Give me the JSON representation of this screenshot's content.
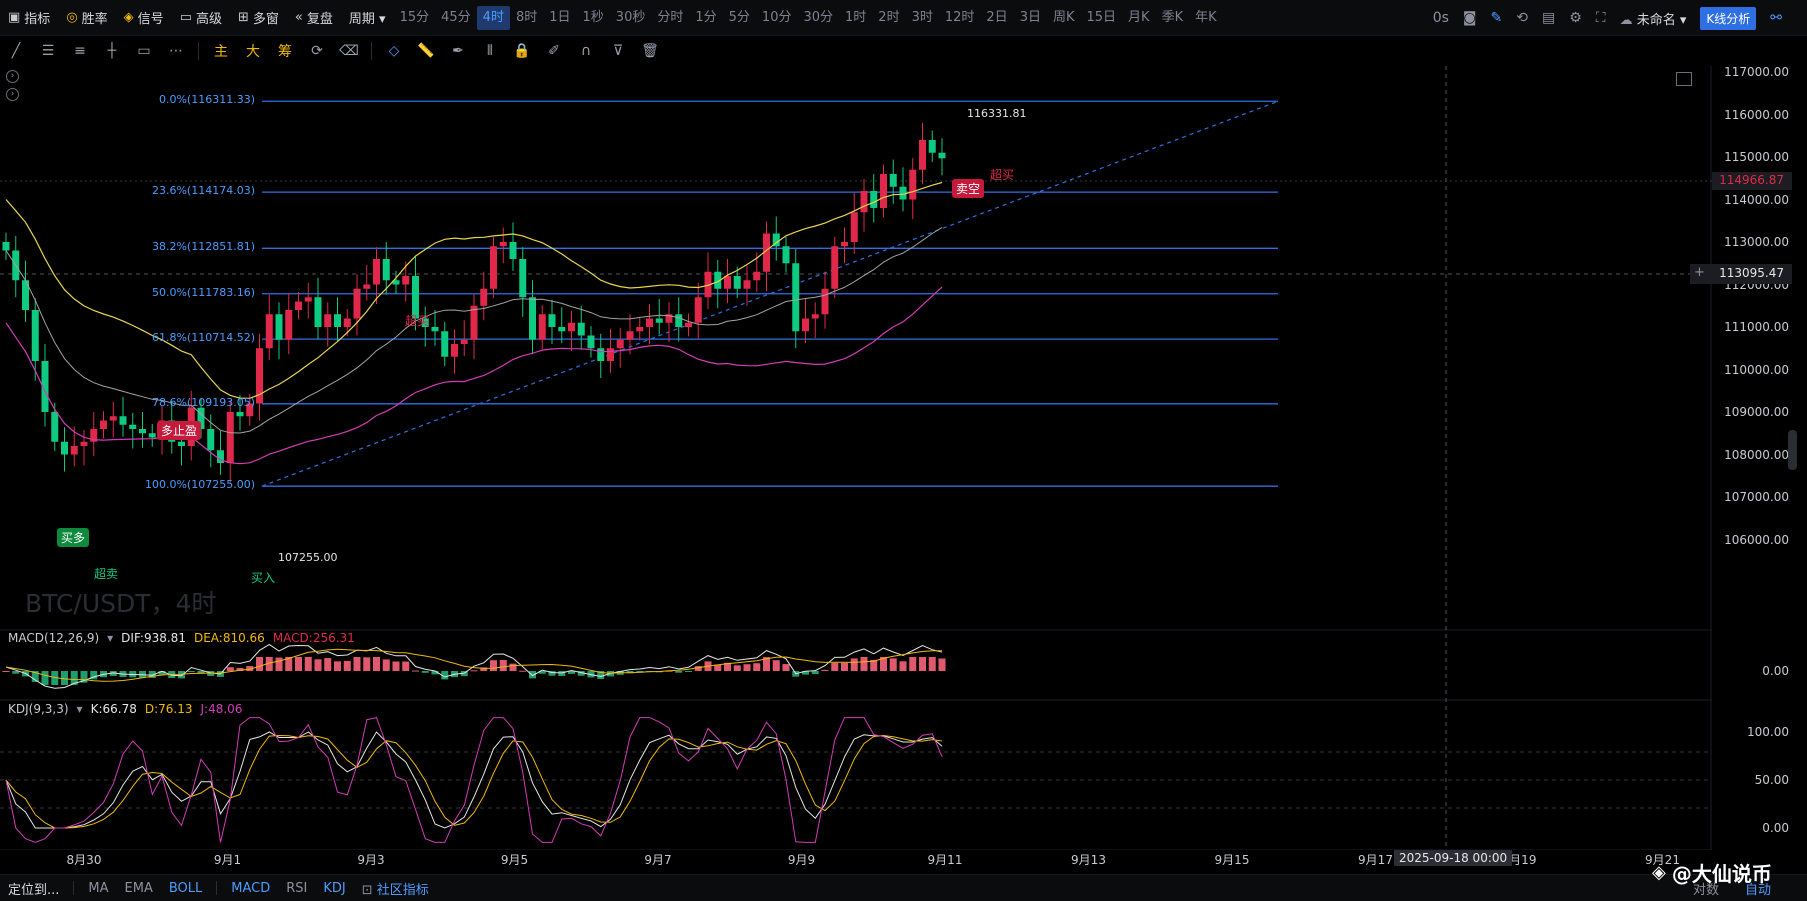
{
  "toolbar": {
    "items": [
      {
        "icon": "indicator-icon",
        "glyph": "▣",
        "label": "指标"
      },
      {
        "icon": "winrate-icon",
        "glyph": "◎",
        "label": "胜率"
      },
      {
        "icon": "signal-icon",
        "glyph": "◈",
        "label": "信号"
      },
      {
        "icon": "advanced-icon",
        "glyph": "▭",
        "label": "高级"
      },
      {
        "icon": "multiwindow-icon",
        "glyph": "⊞",
        "label": "多窗"
      },
      {
        "icon": "replay-icon",
        "glyph": "«",
        "label": "复盘"
      },
      {
        "icon": "period-icon",
        "glyph": "",
        "label": "周期 ▾"
      }
    ],
    "timeframes": [
      "15分",
      "45分",
      "4时",
      "8时",
      "1日",
      "1秒",
      "30秒",
      "分时",
      "1分",
      "5分",
      "10分",
      "30分",
      "1时",
      "2时",
      "3时",
      "12时",
      "2日",
      "3日",
      "周K",
      "15日",
      "月K",
      "季K",
      "年K"
    ],
    "active_timeframe": "4时",
    "right": {
      "latency": "0s",
      "unnamed": "未命名 ▾",
      "kline_analysis": "K线分析"
    }
  },
  "drawing_tools": {
    "left": [
      "trendline-icon",
      "horizontal-lines-icon",
      "parallel-lines-icon",
      "crosshair-line-icon",
      "rectangle-icon",
      "more-icon"
    ],
    "middle_labels": [
      "主",
      "大",
      "筹"
    ],
    "right": [
      "loop-icon",
      "eraser-icon",
      "shape-icon",
      "ruler-icon",
      "pen-icon",
      "candle-tool-icon",
      "lock-icon",
      "edit-icon",
      "magnet-icon",
      "filter-icon",
      "trash-icon"
    ]
  },
  "main_chart": {
    "symbol_watermark": "BTC/USDT，4时",
    "price_axis": [
      "117000.00",
      "116000.00",
      "115000.00",
      "114000.00",
      "113000.00",
      "112000.00",
      "111000.00",
      "110000.00",
      "109000.00",
      "108000.00",
      "107000.00",
      "106000.00"
    ],
    "current_price": "114966.87",
    "crosshair_price": "113095.47",
    "high_label": "116331.81",
    "low_label": "107255.00",
    "fib_levels": [
      {
        "label": "0.0%(116311.33)",
        "price": 116311.33
      },
      {
        "label": "23.6%(114174.03)",
        "price": 114174.03
      },
      {
        "label": "38.2%(112851.81)",
        "price": 112851.81
      },
      {
        "label": "50.0%(111783.16)",
        "price": 111783.16
      },
      {
        "label": "61.8%(110714.52)",
        "price": 110714.52
      },
      {
        "label": "78.6%(109193.05)",
        "price": 109193.05
      },
      {
        "label": "100.0%(107255.00)",
        "price": 107255.0
      }
    ],
    "signals": [
      {
        "text": "买多",
        "kind": "buy-long-chip"
      },
      {
        "text": "超卖",
        "kind": "oversold-text"
      },
      {
        "text": "多止盈",
        "kind": "take-profit-chip"
      },
      {
        "text": "买入",
        "kind": "buy-text"
      },
      {
        "text": "超买",
        "kind": "overbought-text-1"
      },
      {
        "text": "卖空",
        "kind": "sell-short-chip"
      },
      {
        "text": "超买",
        "kind": "overbought-text-2"
      }
    ]
  },
  "macd": {
    "name": "MACD(12,26,9)",
    "dif": "DIF:938.81",
    "dea": "DEA:810.66",
    "macd": "MACD:256.31",
    "axis": [
      "0.00"
    ]
  },
  "kdj": {
    "name": "KDJ(9,3,3)",
    "k": "K:66.78",
    "d": "D:76.13",
    "j": "J:48.06",
    "axis": [
      "100.00",
      "50.00",
      "0.00"
    ]
  },
  "time_axis": {
    "labels": [
      "8月30",
      "9月1",
      "9月3",
      "9月5",
      "9月7",
      "9月9",
      "9月11",
      "9月13",
      "9月15",
      "9月17",
      "9月19",
      "9月21"
    ],
    "crosshair_time": "2025-09-18 00:00"
  },
  "bottom_bar": {
    "locate": "定位到...",
    "indicators": [
      "MA",
      "EMA",
      "BOLL"
    ],
    "sub_indicators": [
      "MACD",
      "RSI",
      "KDJ"
    ],
    "community": "社区指标",
    "right": [
      "对数",
      "自动"
    ]
  },
  "watermark": "@大仙说币",
  "colors": {
    "up": "#e0294a",
    "down": "#0ecb81",
    "fib": "#2f6fe4",
    "boll_mid": "#a3a3a3",
    "boll_up": "#e8d44d",
    "boll_low": "#d23cb5",
    "accent": "#4d9cff"
  }
}
